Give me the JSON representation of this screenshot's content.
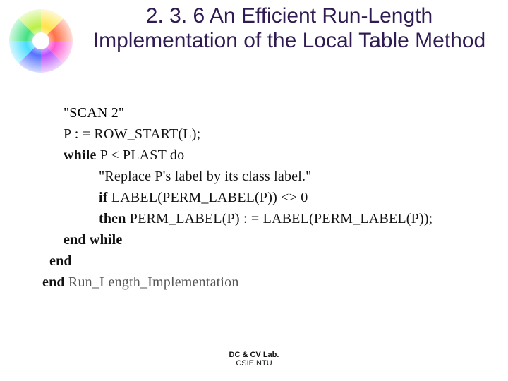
{
  "title": "2. 3. 6 An Efficient Run-Length Implementation of the Local Table Method",
  "code": {
    "line1": "\"SCAN 2\"",
    "line2_pre": "P : = ROW",
    "line2_sep": "_",
    "line2_post": "START(L);",
    "line3_kw": "while",
    "line3_rest": " P ≤ PLAST do",
    "line4": "\"Replace P's label by its class label.\"",
    "line5_kw": "if",
    "line5_mid": " LABEL(PERM",
    "line5_sep": "_",
    "line5_post": "LABEL(P)) <> 0",
    "line6_kw": "then",
    "line6_a": " PERM",
    "line6_sep1": "_",
    "line6_b": "LABEL(P) : = LABEL(PERM",
    "line6_sep2": "_",
    "line6_c": "LABEL(P));",
    "line7": "end while",
    "line8": "end",
    "line9_kw": "end",
    "line9_a": " Run",
    "line9_sep1": "_",
    "line9_b": "Length",
    "line9_sep2": "_",
    "line9_c": "Implementation"
  },
  "footer": {
    "lab": "DC & CV Lab.",
    "org": "CSIE NTU"
  }
}
